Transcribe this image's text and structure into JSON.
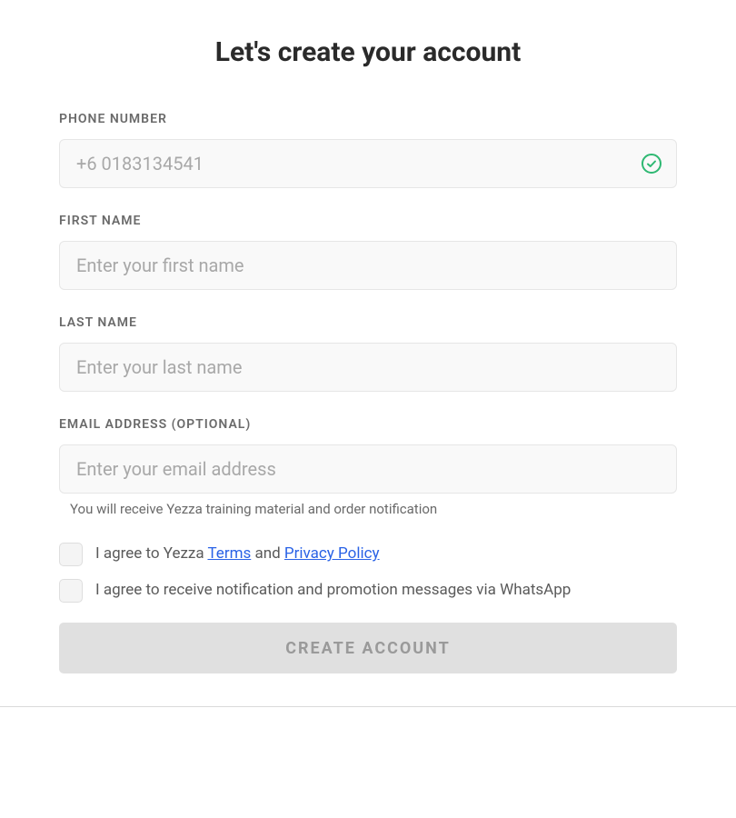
{
  "title": "Let's create your account",
  "phone": {
    "label": "PHONE NUMBER",
    "value": "+6 0183134541",
    "valid": true
  },
  "first_name": {
    "label": "FIRST NAME",
    "placeholder": "Enter your first name"
  },
  "last_name": {
    "label": "LAST NAME",
    "placeholder": "Enter your last name"
  },
  "email": {
    "label": "EMAIL ADDRESS (OPTIONAL)",
    "placeholder": "Enter your email address",
    "help": "You will receive Yezza training material and order notification"
  },
  "consent": {
    "terms_prefix": "I agree to Yezza ",
    "terms_link": "Terms",
    "terms_mid": " and ",
    "privacy_link": "Privacy Policy",
    "whatsapp": "I agree to receive notification and promotion messages via WhatsApp"
  },
  "submit_label": "CREATE ACCOUNT"
}
